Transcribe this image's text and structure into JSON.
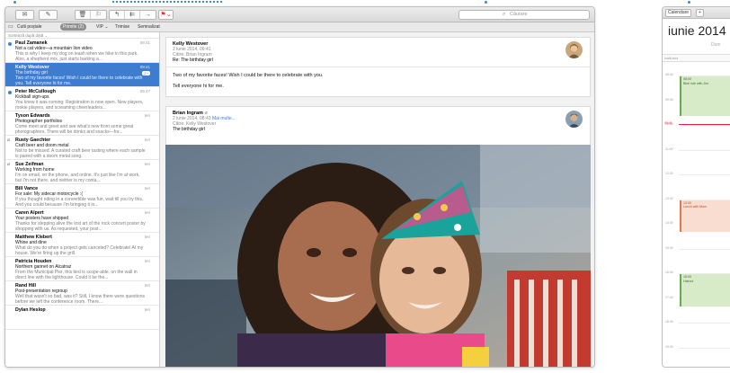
{
  "mail": {
    "toolbar": {
      "compose_icon": "envelope-icon",
      "new_icon": "compose-icon",
      "trash_icon": "trash-icon",
      "junk_icon": "junk-icon",
      "reply_icons": [
        "↰",
        "⇇",
        "→"
      ],
      "flag_icon": "flag-icon",
      "search_placeholder": "Căutare"
    },
    "favorites": {
      "mailboxes": "Cutii poștale",
      "inbox": "Primite (2)",
      "vip": "VIP ⌄",
      "sent": "Trimise",
      "drafts": "Semnalizat"
    },
    "sort_label": "Sortează după dată ⌄",
    "messages": [
      {
        "from": "Paul Zamanek",
        "date": "09:41",
        "subject": "Not a cat video—a mountain lion video",
        "preview": "This is why I keep my dog on leash when we hike in this park. Also, a shepherd mix, just starts barking a...",
        "unread": true,
        "attachment": true
      },
      {
        "from": "Kelly Westover",
        "date": "09:41",
        "subject": "The birthday girl",
        "preview": "Two of my favorite faces! Wish I could be there to celebrate with you. Tell everyone hi for me.",
        "selected": true,
        "badge": "2 ›"
      },
      {
        "from": "Peter McCullough",
        "date": "09:47",
        "subject": "Kickball sign-ups",
        "preview": "You knew it was coming: Registration is now open. New players, rookie players, and screaming cheerleaders...",
        "unread": true
      },
      {
        "from": "Tyson Edwards",
        "date": "Ieri",
        "subject": "Photographer portfolios",
        "preview": "Come meet and greet and see what's new from some great photographers. There will be drinks and snacks—for..."
      },
      {
        "from": "Rusty Gaechter",
        "date": "Ieri",
        "subject": "Craft beer and doom metal",
        "preview": "Not to be missed. A curated craft beer tasting where each sample is paired with a doom metal song.",
        "attachment": true
      },
      {
        "from": "Sue Zeifman",
        "date": "Ieri",
        "subject": "Working from home",
        "preview": "I'm on email, on the phone, and online. It's just like I'm at work, but I'm not there, and neither is my conta...",
        "attachment": true
      },
      {
        "from": "Bill Vance",
        "date": "Ieri",
        "subject": "For sale: My sidecar motorcycle :(",
        "preview": "If you thought riding in a convertible was fun, wait till you try this. And you could because I'm bringing it in..."
      },
      {
        "from": "Caren Alpert",
        "date": "Ieri",
        "subject": "Your posters have shipped",
        "preview": "Thanks for stepping alive the lost art of the rock concert poster by shopping with us. As requested, your post..."
      },
      {
        "from": "Matthew Klebert",
        "date": "Ieri",
        "subject": "Whine and dine",
        "preview": "What do you do when a project gets canceled? Celebrate! At my house. We're firing up the grill."
      },
      {
        "from": "Patricia Houden",
        "date": "Ieri",
        "subject": "Northern gannet on Alcatraz",
        "preview": "From the Municipal Pier, this bird is scope-able, on the wall in direct line with the lighthouse. Could it be the..."
      },
      {
        "from": "Rand Hill",
        "date": "Ieri",
        "subject": "Post-presentation regroup",
        "preview": "Well that wasn't so bad, was it? Still, I know there were questions before we left the conference room. There..."
      },
      {
        "from": "Dylan Heslop",
        "date": "Ieri",
        "subject": "",
        "preview": ""
      }
    ],
    "reader": {
      "first": {
        "from": "Kelly Westover",
        "date": "2 iunie 2014, 09:41",
        "to": "Către: Brian Ingram",
        "subject": "Re: The birthday girl",
        "body1": "Two of my favorite faces! Wish I could be there to celebrate with you.",
        "body2": "Tell everyone hi for me."
      },
      "second": {
        "from": "Brian Ingram",
        "date": "2 iunie 2014, 08:43",
        "more": "Mai multe...",
        "to": "Către: Kelly Westover",
        "subject": "The birthday girl"
      }
    }
  },
  "calendar": {
    "toolbar_label": "Calendare",
    "add_label": "+",
    "title": "iunie 2014",
    "day_label": "Dum",
    "allday_label": "toată ziua",
    "hours": [
      "08:00",
      "09:00",
      "10:00",
      "11:00",
      "12:00",
      "13:00",
      "14:00",
      "15:00",
      "16:00",
      "17:00",
      "18:00",
      "19:00"
    ],
    "now_label": "09:41",
    "events": [
      {
        "time": "08:00",
        "title": "Bike ride with Jim",
        "color": "green"
      },
      {
        "time": "13:00",
        "title": "Lunch with Mom",
        "color": "orange"
      },
      {
        "time": "16:00",
        "title": "Haircut",
        "color": "green"
      }
    ]
  }
}
